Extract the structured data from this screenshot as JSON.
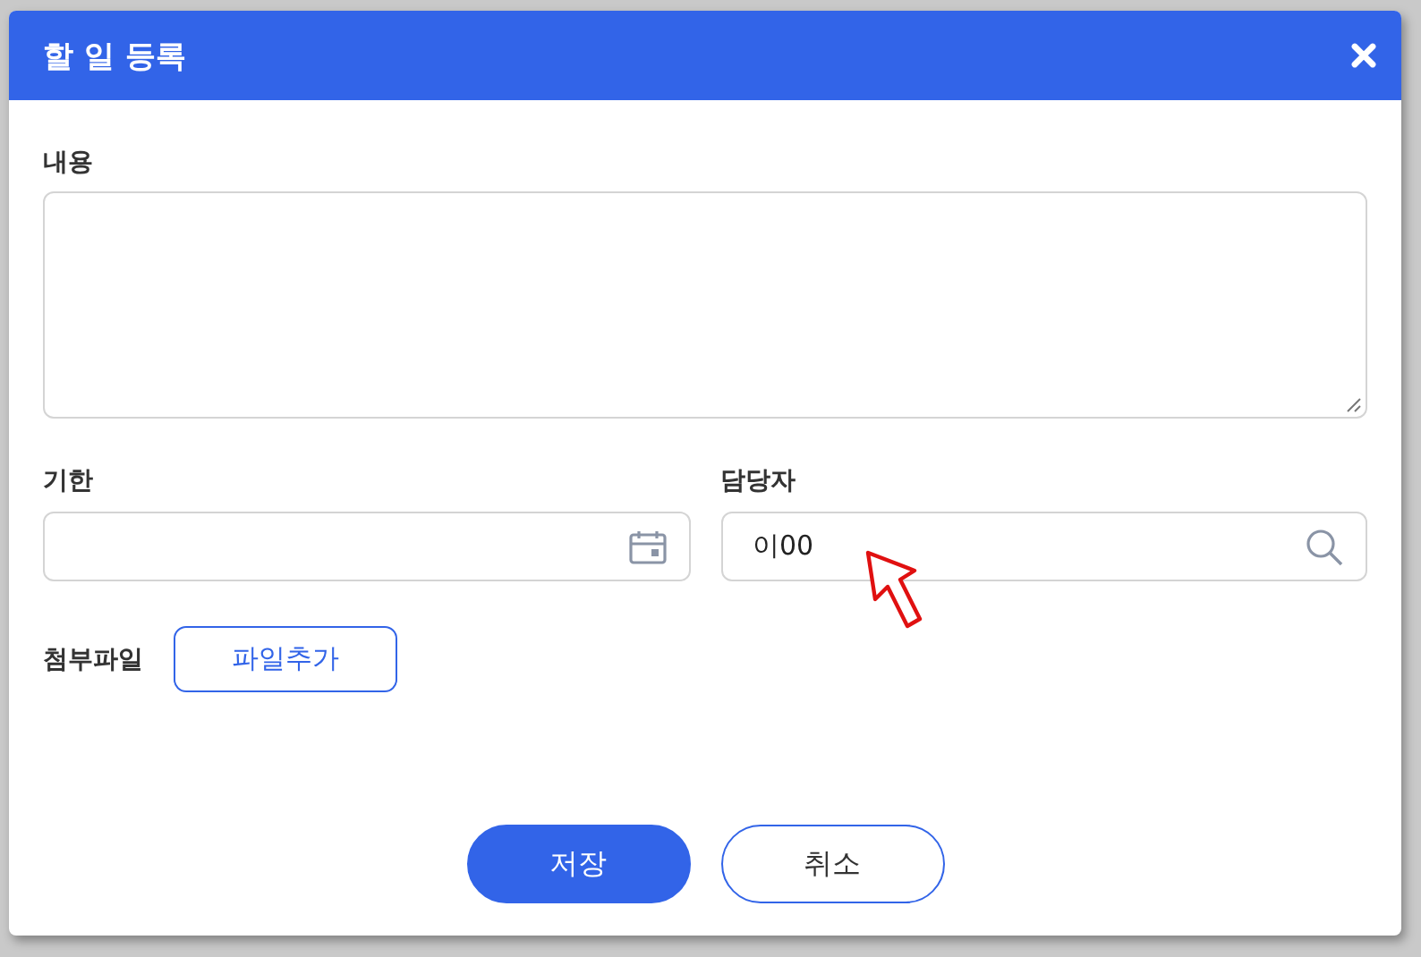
{
  "dialog": {
    "title": "할 일 등록"
  },
  "content": {
    "label": "내용"
  },
  "deadline": {
    "label": "기한"
  },
  "assignee": {
    "label": "담당자",
    "value": "이00"
  },
  "attachment": {
    "label": "첨부파일",
    "button": "파일추가"
  },
  "buttons": [
    {
      "label": "저장",
      "kind": "primary"
    },
    {
      "label": "취소",
      "kind": "secondary"
    }
  ]
}
